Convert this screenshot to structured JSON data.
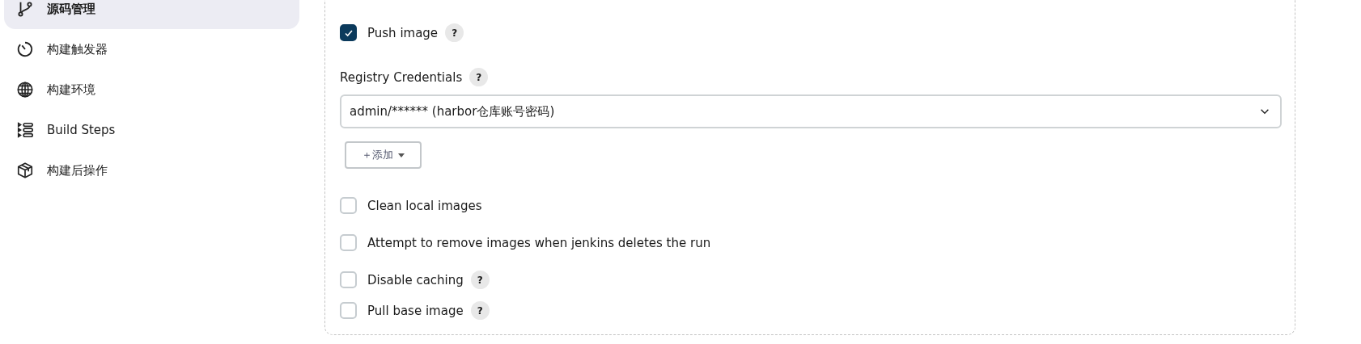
{
  "sidebar": {
    "items": [
      {
        "label": "源码管理",
        "selected": true
      },
      {
        "label": "构建触发器",
        "selected": false
      },
      {
        "label": "构建环境",
        "selected": false
      },
      {
        "label": "Build Steps",
        "selected": false
      },
      {
        "label": "构建后操作",
        "selected": false
      }
    ]
  },
  "form": {
    "push": {
      "label": "Push image",
      "checked": true,
      "help": "?"
    },
    "credentials": {
      "label": "Registry Credentials",
      "help": "?",
      "value": "admin/****** (harbor仓库账号密码)",
      "add_button": "＋添加"
    },
    "options": [
      {
        "label": "Clean local images",
        "checked": false
      },
      {
        "label": "Attempt to remove images when jenkins deletes the run",
        "checked": false
      },
      {
        "label": "Disable caching",
        "checked": false,
        "help": "?"
      },
      {
        "label": "Pull base image",
        "checked": false,
        "help": "?"
      }
    ]
  }
}
